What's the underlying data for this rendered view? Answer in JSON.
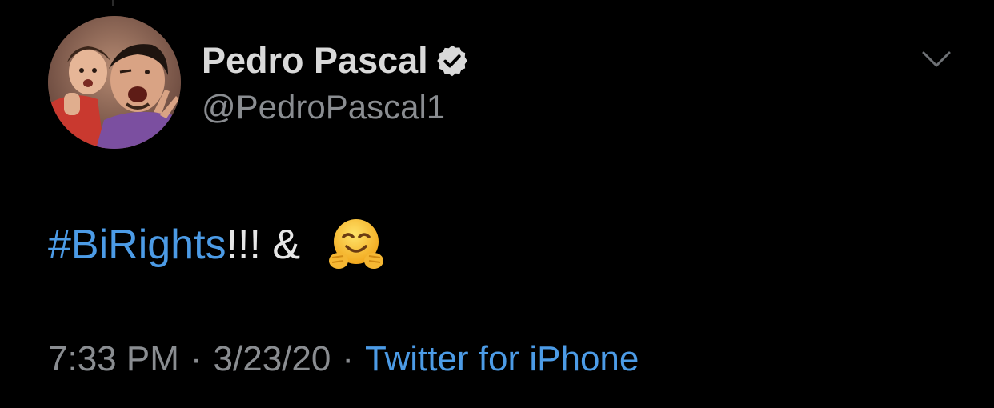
{
  "tweet": {
    "author": {
      "display_name": "Pedro Pascal",
      "handle": "@PedroPascal1",
      "verified": true,
      "avatar_icon": "profile-photo"
    },
    "text": {
      "hashtag": "#BiRights",
      "rest": "!!! & ",
      "emoji": "hugging-face-emoji"
    },
    "meta": {
      "time": "7:33 PM",
      "separator": "·",
      "date": "3/23/20",
      "source": "Twitter for iPhone"
    },
    "menu_icon": "chevron-down-icon"
  },
  "colors": {
    "background": "#000000",
    "primary_text": "#d9d9d9",
    "secondary_text": "#8a8d91",
    "link": "#4c9be6"
  }
}
